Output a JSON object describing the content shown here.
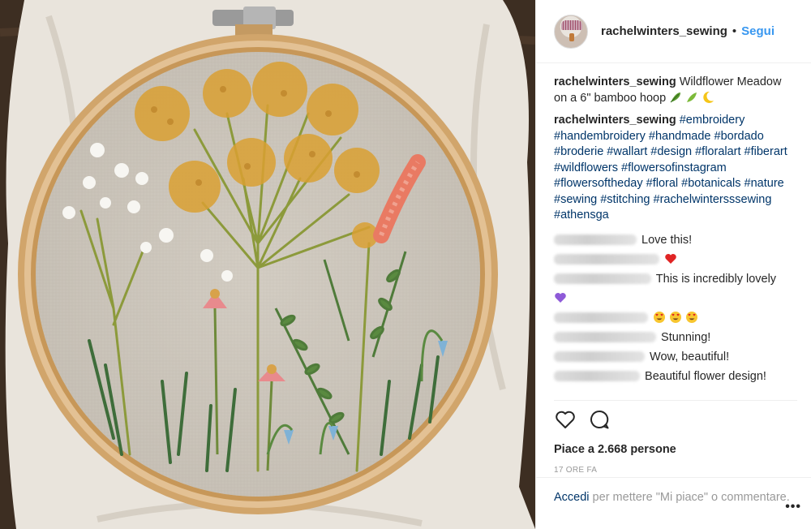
{
  "header": {
    "username": "rachelwinters_sewing",
    "dot": "•",
    "follow": "Segui"
  },
  "caption": {
    "username": "rachelwinters_sewing",
    "text": "Wildflower Meadow on a 6\" bamboo hoop"
  },
  "hashtags_comment": {
    "username": "rachelwinters_sewing",
    "tags": "#embroidery #handembroidery #handmade #bordado #broderie #wallart #design #floralart #fiberart #wildflowers #flowersofinstagram #flowersoftheday #floral #botanicals #nature #sewing #stitching #rachelwintersssewing #athensga"
  },
  "comments": [
    {
      "text": "Love this!",
      "emoji": ""
    },
    {
      "text": "",
      "emoji": "red-heart"
    },
    {
      "text": "This is incredibly lovely",
      "emoji": ""
    },
    {
      "text": "",
      "emoji": "purple-heart"
    },
    {
      "text": "",
      "emoji": "heart-eyes x3"
    },
    {
      "text": "Stunning!",
      "emoji": ""
    },
    {
      "text": "Wow, beautiful!",
      "emoji": ""
    },
    {
      "text": "Beautiful flower design!",
      "emoji": ""
    }
  ],
  "likes": "Piace a 2.668 persone",
  "time": "17 ORE FA",
  "login": {
    "link": "Accedi",
    "rest": " per mettere \"Mi piace\" o commentare."
  },
  "more": "•••",
  "icons": {
    "like": "heart-icon",
    "comment": "comment-icon"
  }
}
